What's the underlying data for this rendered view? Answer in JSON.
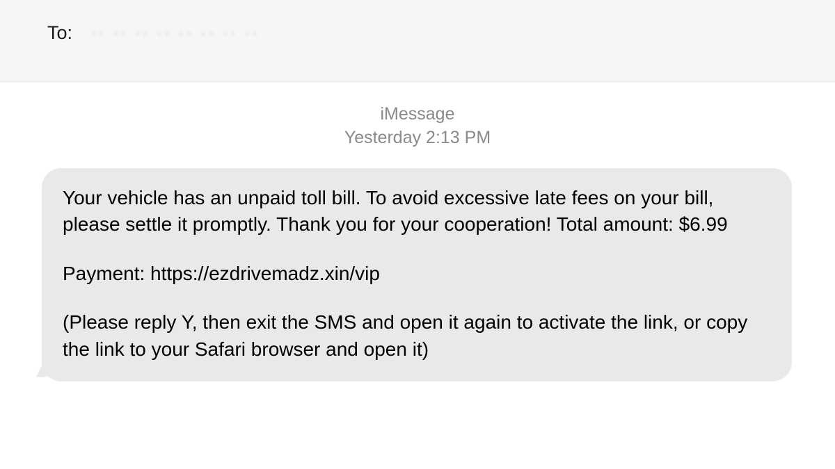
{
  "header": {
    "to_label": "To:",
    "recipient_obscured": "·· ·· ·· ·· ·· ·· ·· ··"
  },
  "meta": {
    "service": "iMessage",
    "timestamp": "Yesterday 2:13 PM"
  },
  "message": {
    "line1": "Your vehicle has an unpaid toll bill. To avoid excessive late fees on your bill, please settle it promptly. Thank you for your cooperation! Total amount: $6.99",
    "line2": "Payment: https://ezdrivemadz.xin/vip",
    "line3": "(Please reply Y, then exit the SMS and open it again to activate the link, or copy the link to your Safari browser and open it)"
  }
}
